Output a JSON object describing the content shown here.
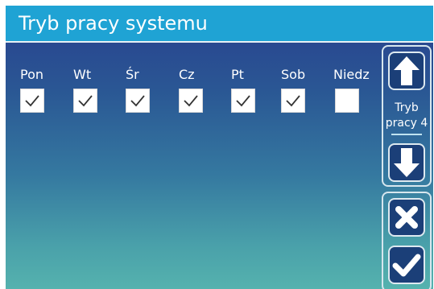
{
  "title": "Tryb pracy systemu",
  "days": [
    {
      "label": "Pon",
      "checked": true
    },
    {
      "label": "Wt",
      "checked": true
    },
    {
      "label": "Śr",
      "checked": true
    },
    {
      "label": "Cz",
      "checked": true
    },
    {
      "label": "Pt",
      "checked": true
    },
    {
      "label": "Sob",
      "checked": true
    },
    {
      "label": "Niedz",
      "checked": false
    }
  ],
  "mode": {
    "line1": "Tryb",
    "line2": "pracy 4"
  },
  "icons": {
    "up": "arrow-up-icon",
    "down": "arrow-down-icon",
    "cancel": "close-icon",
    "confirm": "checkmark-icon"
  },
  "colors": {
    "title_bar": "#1fa3d4",
    "button_bg": "#1b3f78",
    "gradient_top": "#283f8e",
    "gradient_bottom": "#55b2ae"
  }
}
